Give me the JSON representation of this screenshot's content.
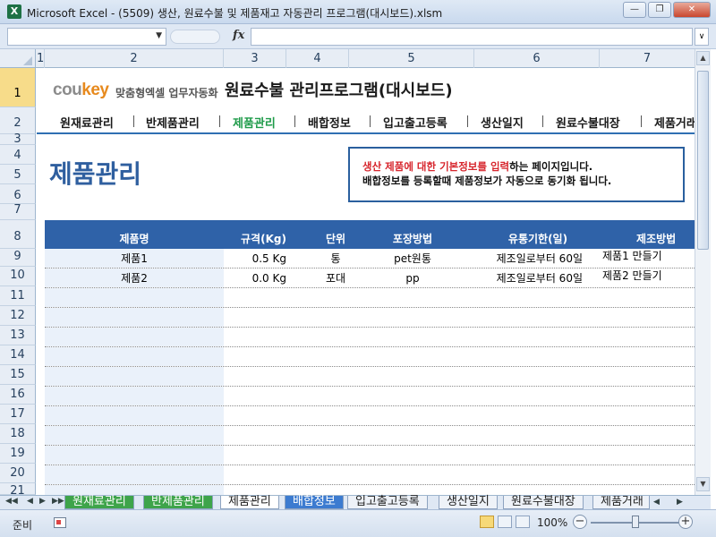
{
  "window": {
    "app_icon": "X",
    "title": "Microsoft Excel - (5509) 생산, 원료수불 및 제품재고 자동관리 프로그램(대시보드).xlsm"
  },
  "formula": {
    "fx": "fx",
    "name_value": "",
    "formula_value": ""
  },
  "columns": [
    "1",
    "2",
    "3",
    "4",
    "5",
    "6",
    "7"
  ],
  "rows": [
    "1",
    "2",
    "3",
    "4",
    "5",
    "6",
    "7",
    "8",
    "9",
    "10",
    "11",
    "12",
    "13",
    "14",
    "15",
    "16",
    "17",
    "18",
    "19",
    "20",
    "21"
  ],
  "brand": {
    "cou": "cou",
    "key": "key",
    "tagline": "맞춤형엑셀 업무자동화"
  },
  "app_title": "원료수불 관리프로그램(대시보드)",
  "menu": [
    "원재료관리",
    "반제품관리",
    "제품관리",
    "배합정보",
    "입고출고등록",
    "생산일지",
    "원료수불대장",
    "제품거래"
  ],
  "menu_active": "제품관리",
  "page_heading": "제품관리",
  "info": {
    "line1_red": "생산 제품에 대한 기본정보를 입력",
    "line1_rest": "하는 페이지입니다.",
    "line2": "배합정보를 등록할때 제품정보가 자동으로 동기화 됩니다."
  },
  "table": {
    "headers": [
      "제품명",
      "규격(Kg)",
      "단위",
      "포장방법",
      "유통기한(일)",
      "제조방법"
    ],
    "rows": [
      [
        "제품1",
        "0.5 Kg",
        "통",
        "pet원통",
        "제조일로부터 60일",
        "제품1 만들기"
      ],
      [
        "제품2",
        "0.0 Kg",
        "포대",
        "pp",
        "제조일로부터 60일",
        "제품2 만들기"
      ]
    ]
  },
  "tabs": [
    "원재료관리",
    "반제품관리",
    "제품관리",
    "배합정보",
    "입고출고등록",
    "생산일지",
    "원료수불대장",
    "제품거래"
  ],
  "status": {
    "ready": "준비",
    "zoom": "100%",
    "zoom_level": 1.0
  },
  "colors": {
    "accent_blue": "#2f62a8",
    "menu_active_green": "#1f9b4a",
    "heading_blue": "#2f5f9f",
    "highlight_red": "#d7262d",
    "tab_green": "#3ea44a",
    "tab_blue": "#3c7bd0"
  }
}
